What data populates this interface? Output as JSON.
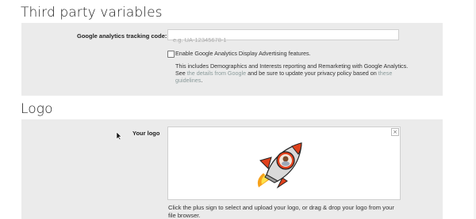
{
  "sections": {
    "third_party": {
      "title": "Third party variables",
      "ga_label": "Google analytics tracking code:",
      "ga_placeholder": "e.g. UA-12345678-1",
      "ga_value": "",
      "checkbox_label": "Enable Google Analytics Display Advertising features.",
      "checkbox_checked": false,
      "desc_line1": "This includes Demographics and Interests reporting and Remarketing with Google Analytics.",
      "desc_see": "See ",
      "desc_link1": "the details from Google",
      "desc_mid": " and be sure to update your privacy policy based on ",
      "desc_link2": "these",
      "desc_link2b": "guidelines",
      "desc_end": "."
    },
    "logo": {
      "title": "Logo",
      "label": "Your logo",
      "remove_glyph": "×",
      "help_line1": "Click the plus sign to select and upload your logo, or drag & drop your logo from your",
      "help_line2": "file browser."
    }
  },
  "icons": {
    "rocket": "rocket-logo-image",
    "cursor": "mouse-pointer"
  },
  "colors": {
    "panel": "#ebebeb",
    "link": "#8a9a9a"
  }
}
